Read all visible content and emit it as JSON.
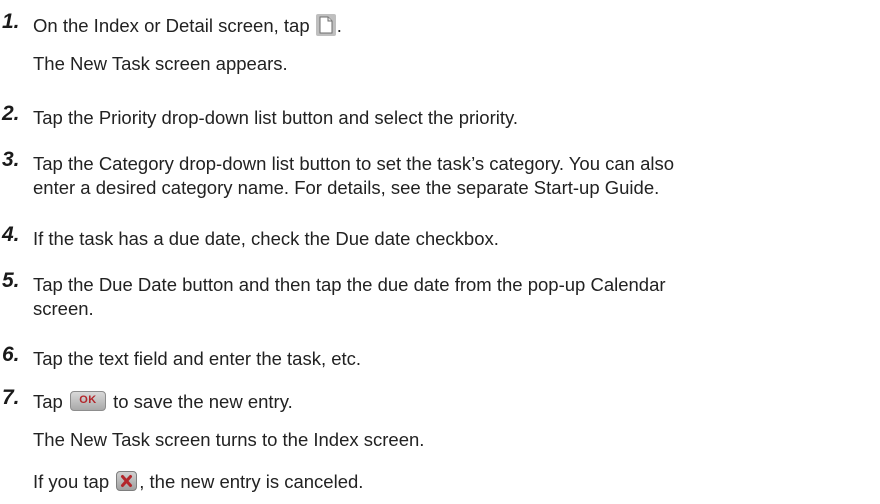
{
  "steps": [
    {
      "number": "1.",
      "text_before": "On the Index or Detail screen, tap",
      "icon": "new-document-icon",
      "text_after": ".",
      "note": "The New Task screen appears."
    },
    {
      "number": "2.",
      "text": "Tap the Priority drop-down list button and select the priority."
    },
    {
      "number": "3.",
      "line1": "Tap the Category drop-down list button to set the task’s category. You can also",
      "line2": "enter a desired category name. For details, see the separate Start-up Guide."
    },
    {
      "number": "4.",
      "text": "If the task has a due date, check the Due date checkbox."
    },
    {
      "number": "5.",
      "line1": "Tap the Due Date button and then tap the due date from the pop-up Calendar",
      "line2": "screen."
    },
    {
      "number": "6.",
      "text": "Tap the text field and enter the task, etc."
    },
    {
      "number": "7.",
      "text_before": "Tap",
      "icon": "ok-button-icon",
      "icon_label": "OK",
      "text_after": "to save the new entry.",
      "note1": "The New Task screen turns to the Index screen.",
      "note2_before": "If you tap",
      "note2_icon": "cancel-x-icon",
      "note2_after": ", the new entry is canceled."
    }
  ],
  "colors": {
    "text": "#222222",
    "ok_label": "#b3262b",
    "button_gray": "#a9a9a9"
  }
}
